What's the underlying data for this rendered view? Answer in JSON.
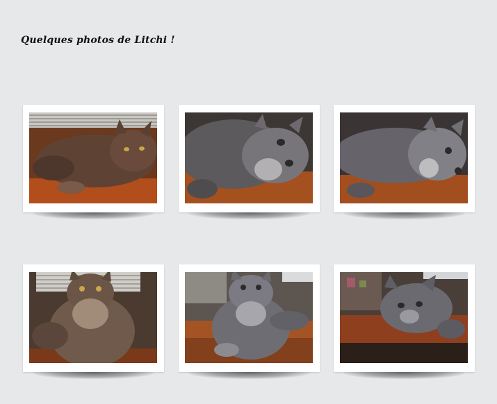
{
  "page": {
    "title": "Quelques photos de Litchi !",
    "background": "#e7e8ea"
  },
  "gallery": {
    "photos": [
      {
        "subject": "cat-photo",
        "alt": "Litchi"
      },
      {
        "subject": "cat-photo",
        "alt": "Litchi"
      },
      {
        "subject": "cat-photo",
        "alt": "Litchi"
      },
      {
        "subject": "cat-photo",
        "alt": "Litchi"
      },
      {
        "subject": "cat-photo",
        "alt": "Litchi"
      },
      {
        "subject": "cat-photo",
        "alt": "Litchi"
      }
    ]
  }
}
